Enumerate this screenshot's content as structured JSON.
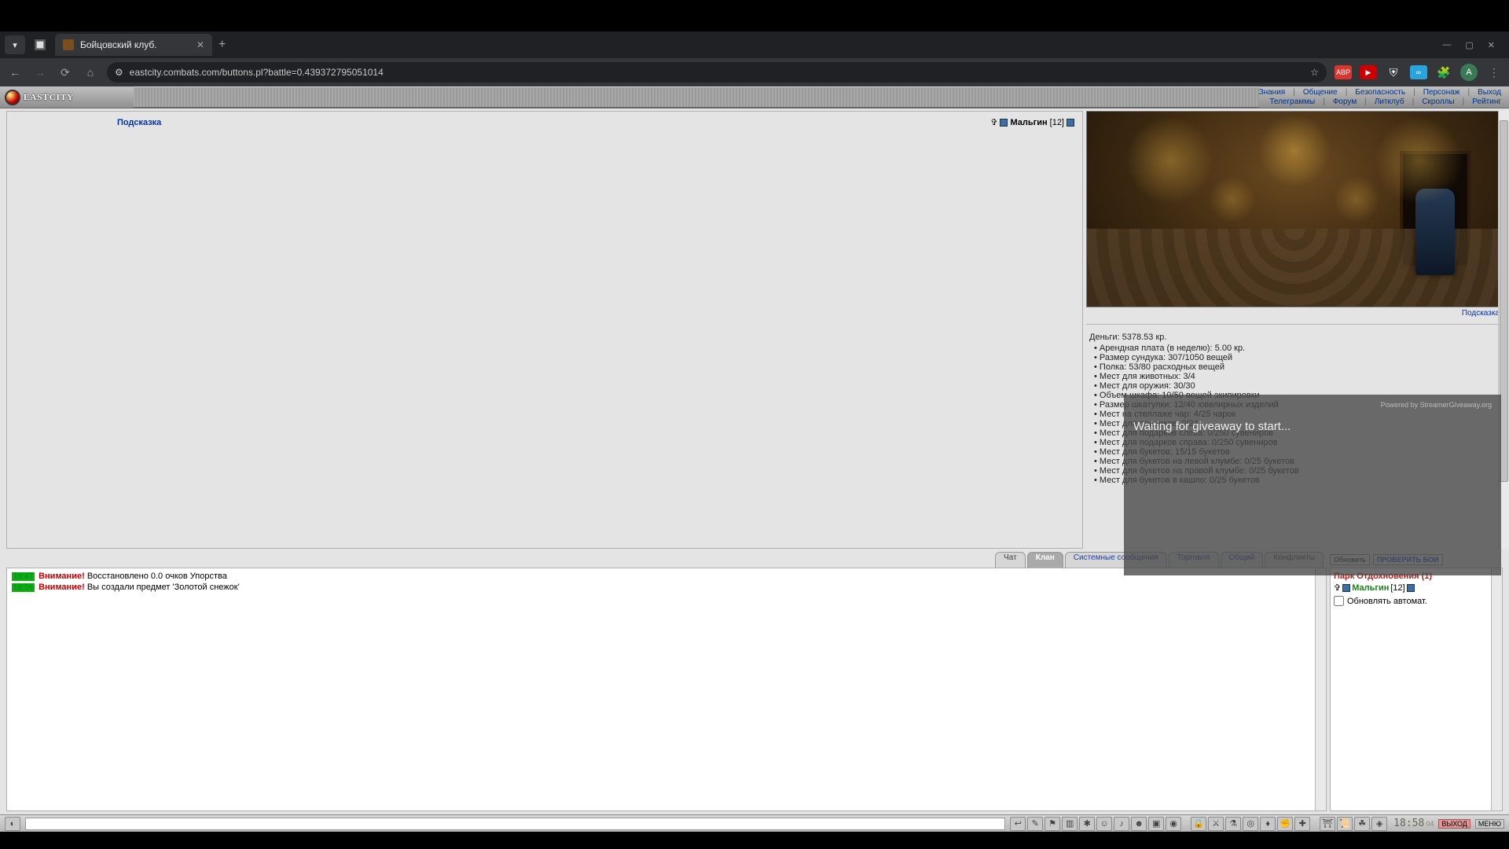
{
  "browser": {
    "tab_title": "Бойцовский клуб.",
    "url": "eastcity.combats.com/buttons.pl?battle=0.439372795051014",
    "avatar_letter": "A",
    "abp": "ABP"
  },
  "topmenu": {
    "row1": [
      "Знания",
      "Общение",
      "Безопасность",
      "Персонаж",
      "Выход"
    ],
    "row2": [
      "Телеграммы",
      "Форум",
      "Литклуб",
      "Скроллы",
      "Рейтинг"
    ]
  },
  "logo": "EASTCITY",
  "left": {
    "hint": "Подсказка",
    "player_name": "Мальгин",
    "player_level": "[12]"
  },
  "right": {
    "hint": "Подсказка",
    "money_label": "Деньги:",
    "money_value": "5378.53 кр.",
    "stats": [
      "Арендная плата (в неделю): 5.00 кр.",
      "Размер сундука: 307/1050 вещей",
      "Полка: 53/80 расходных вещей",
      "Мест для животных: 3/4",
      "Мест для оружия: 30/30",
      "Объем шкафа: 10/50 вещей экипировки",
      "Размер шкатулки: 12/40 ювелирных изделий",
      "Мест на стеллаже чар: 4/25 чарок",
      "Мест для подарков: 0/24",
      "Мест для подарков слева: 0/250 сувениров",
      "Мест для подарков справа: 0/250 сувениров",
      "Мест для букетов: 15/15 букетов",
      "Мест для букетов на левой клумбе: 0/25 букетов",
      "Мест для букетов на правой клумбе: 0/25 букетов",
      "Мест для букетов в кашпо: 0/25 букетов"
    ]
  },
  "giveaway": {
    "powered": "Powered by StreamerGiveaway.org",
    "msg": "Waiting for giveaway to start..."
  },
  "chat": {
    "tabs": [
      "Чат",
      "Клан",
      "Системные сообщения",
      "Торговля",
      "Общий",
      "Конфликты"
    ],
    "lines": [
      {
        "ts": "18:47",
        "warn": "Внимание!",
        "text": "Восстановлено 0.0 очков Упорства"
      },
      {
        "ts": "18:56",
        "warn": "Внимание!",
        "text": "Вы создали предмет 'Золотой снежок'"
      }
    ]
  },
  "rightchat": {
    "refresh": "Обновить",
    "check": "ПРОВЕРИТЬ БОИ",
    "location": "Парк Отдохновения (1)",
    "player_name": "Мальгин",
    "player_level": "[12]",
    "auto": "Обновлять автомат."
  },
  "bottom": {
    "clock": "18:58",
    "clock_sec": "04",
    "exit": "ВЫХОД",
    "menu": "МЕНЮ"
  }
}
